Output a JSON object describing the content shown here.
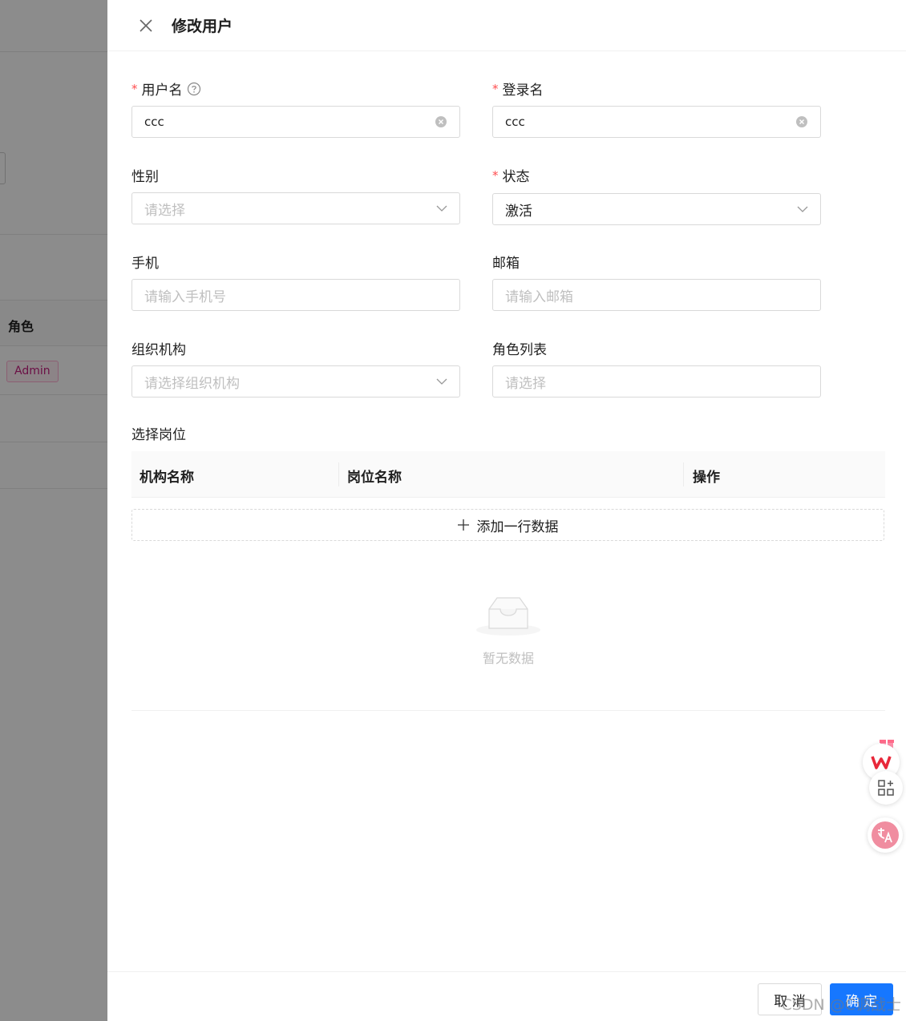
{
  "drawer": {
    "title": "修改用户"
  },
  "form": {
    "username": {
      "label": "用户名",
      "required": true,
      "value": "ccc"
    },
    "login_name": {
      "label": "登录名",
      "required": true,
      "value": "ccc"
    },
    "gender": {
      "label": "性别",
      "placeholder": "请选择"
    },
    "status": {
      "label": "状态",
      "required": true,
      "value": "激活"
    },
    "phone": {
      "label": "手机",
      "placeholder": "请输入手机号"
    },
    "email": {
      "label": "邮箱",
      "placeholder": "请输入邮箱"
    },
    "org": {
      "label": "组织机构",
      "placeholder": "请选择组织机构"
    },
    "roles": {
      "label": "角色列表",
      "placeholder": "请选择"
    }
  },
  "positions": {
    "label": "选择岗位",
    "columns": [
      "机构名称",
      "岗位名称",
      "操作"
    ],
    "add_row_label": "添加一行数据",
    "empty_text": "暂无数据"
  },
  "footer": {
    "cancel_label": "取 消",
    "ok_label": "确 定"
  },
  "background": {
    "column_header": "角色",
    "role_tag": "Admin"
  },
  "watermark": "CSDN @C调战士",
  "colors": {
    "primary": "#1677ff",
    "required": "#ff4d4f",
    "tag_text": "#c41d7f"
  }
}
